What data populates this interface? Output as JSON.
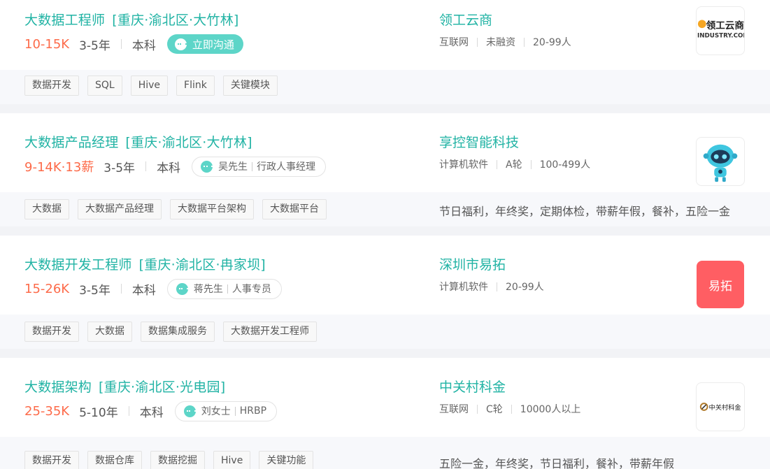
{
  "jobs": [
    {
      "title": "大数据工程师",
      "location": "[重庆·渝北区·大竹林]",
      "salary": "10-15K",
      "experience": "3-5年",
      "education": "本科",
      "chat_label": "立即沟通",
      "company": "领工云商",
      "company_meta": [
        "互联网",
        "未融资",
        "20-99人"
      ],
      "logo_text": [
        "领工云商",
        "INDUSTRY.COM"
      ],
      "tags": [
        "数据开发",
        "SQL",
        "Hive",
        "Flink",
        "关键模块"
      ],
      "welfare": ""
    },
    {
      "title": "大数据产品经理",
      "location": "[重庆·渝北区·大竹林]",
      "salary": "9-14K·13薪",
      "experience": "3-5年",
      "education": "本科",
      "recruiter_name": "吴先生",
      "recruiter_role": "行政人事经理",
      "company": "享控智能科技",
      "company_meta": [
        "计算机软件",
        "A轮",
        "100-499人"
      ],
      "tags": [
        "大数据",
        "大数据产品经理",
        "大数据平台架构",
        "大数据平台"
      ],
      "welfare": "节日福利，年终奖，定期体检，带薪年假，餐补，五险一金"
    },
    {
      "title": "大数据开发工程师",
      "location": "[重庆·渝北区·冉家坝]",
      "salary": "15-26K",
      "experience": "3-5年",
      "education": "本科",
      "recruiter_name": "蒋先生",
      "recruiter_role": "人事专员",
      "company": "深圳市易拓",
      "company_meta": [
        "计算机软件",
        "20-99人"
      ],
      "logo_text": [
        "易拓"
      ],
      "tags": [
        "数据开发",
        "大数据",
        "数据集成服务",
        "大数据开发工程师"
      ],
      "welfare": ""
    },
    {
      "title": "大数据架构",
      "location": "[重庆·渝北区·光电园]",
      "salary": "25-35K",
      "experience": "5-10年",
      "education": "本科",
      "recruiter_name": "刘女士",
      "recruiter_role": "HRBP",
      "company": "中关村科金",
      "company_meta": [
        "互联网",
        "C轮",
        "10000人以上"
      ],
      "logo_text": [
        "中关村科金"
      ],
      "tags": [
        "数据开发",
        "数据仓库",
        "数据挖掘",
        "Hive",
        "关键功能"
      ],
      "welfare": "五险一金，年终奖，节日福利，餐补，带薪年假"
    }
  ],
  "colors": {
    "accent": "#21b3a4",
    "salary": "#fd6b4a",
    "chat_button": "#5dd5c8",
    "yituo_logo": "#ff5e63"
  }
}
